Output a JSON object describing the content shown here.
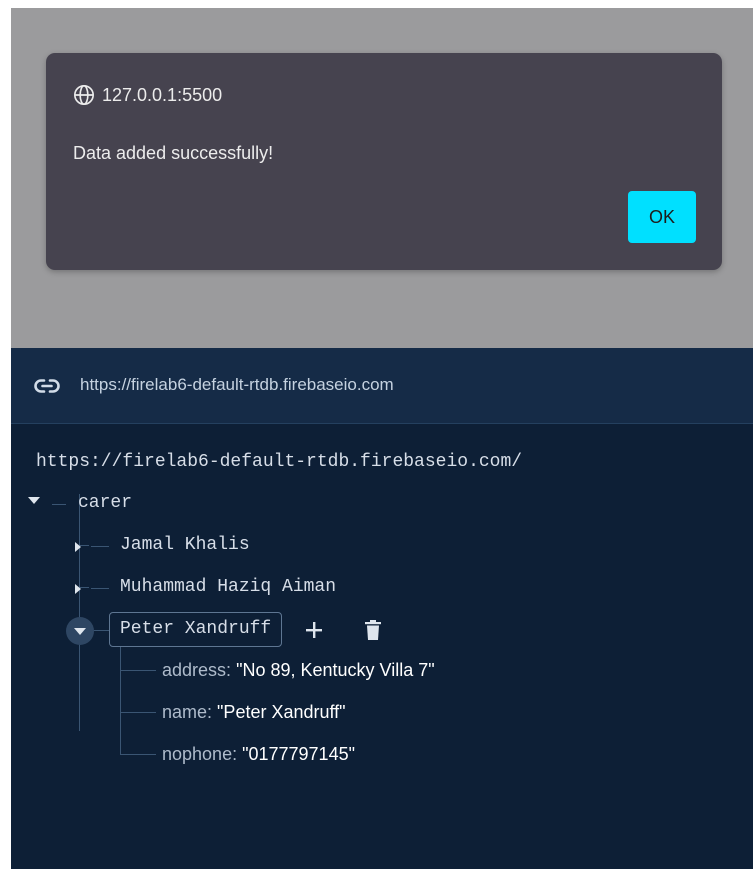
{
  "dialog": {
    "origin": "127.0.0.1:5500",
    "message": "Data added successfully!",
    "ok_label": "OK"
  },
  "database": {
    "url_bar": "https://firelab6-default-rtdb.firebaseio.com",
    "root_url": "https://firelab6-default-rtdb.firebaseio.com/",
    "root_node": "carer",
    "children": [
      {
        "key": "Jamal Khalis",
        "expanded": false
      },
      {
        "key": "Muhammad Haziq Aiman",
        "expanded": false
      },
      {
        "key": "Peter Xandruff",
        "expanded": true
      }
    ],
    "selected_properties": [
      {
        "key": "address",
        "value": "\"No 89, Kentucky Villa 7\""
      },
      {
        "key": "name",
        "value": "\"Peter Xandruff\""
      },
      {
        "key": "nophone",
        "value": "\"0177797145\""
      }
    ]
  },
  "colors": {
    "accent": "#00e0ff",
    "dialog_bg": "#46434f",
    "panel_bg": "#0d1f36"
  }
}
